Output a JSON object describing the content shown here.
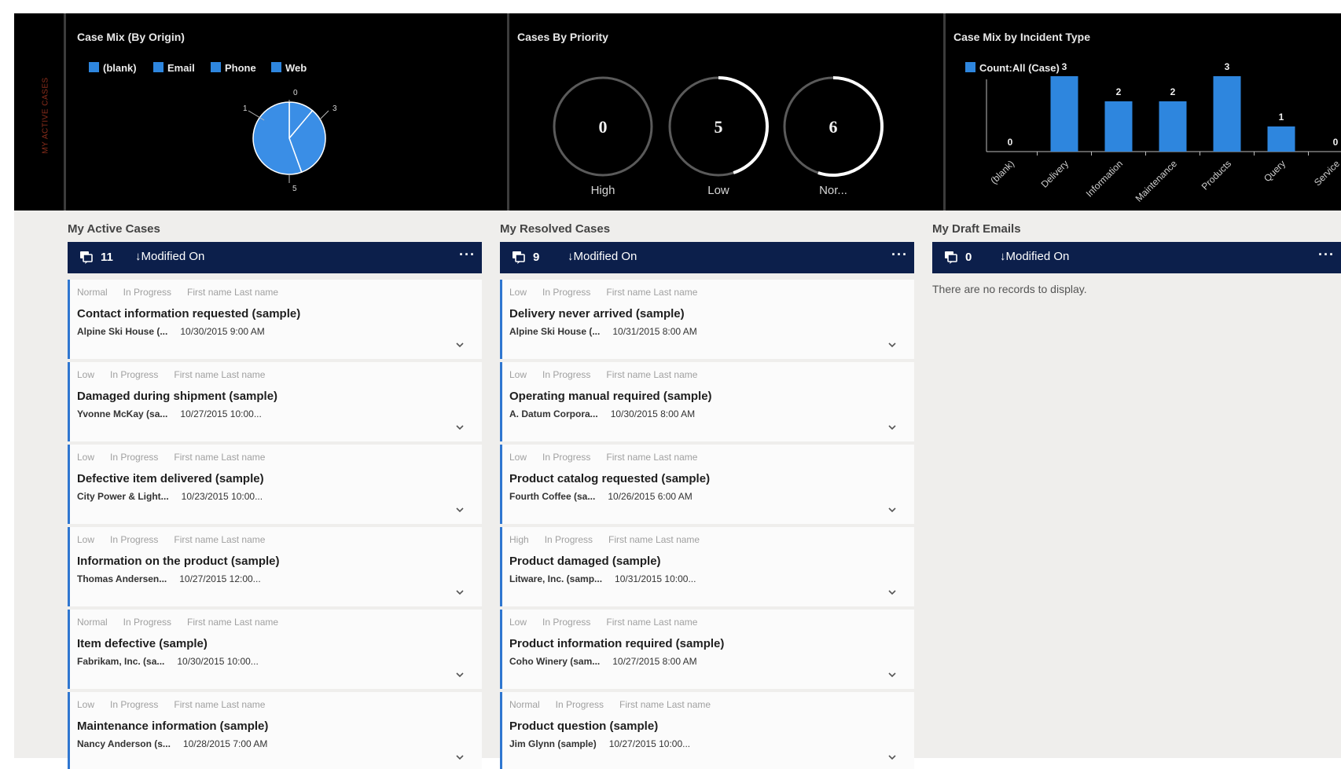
{
  "dashboard": {
    "side_label": "MY ACTIVE CASES"
  },
  "charts": {
    "origin": {
      "title": "Case Mix (By Origin)",
      "legend": [
        {
          "label": "(blank)",
          "color": "#2e86de"
        },
        {
          "label": "Email",
          "color": "#2e86de"
        },
        {
          "label": "Phone",
          "color": "#2e86de"
        },
        {
          "label": "Web",
          "color": "#2e86de"
        }
      ],
      "slice_labels": [
        "1",
        "3",
        "0",
        "5"
      ]
    },
    "priority": {
      "title": "Cases By Priority",
      "gauges": [
        {
          "value": "0",
          "label": "High",
          "fraction": 0
        },
        {
          "value": "5",
          "label": "Low",
          "fraction": 0.45
        },
        {
          "value": "6",
          "label": "Nor...",
          "fraction": 0.55
        }
      ]
    },
    "incident": {
      "title": "Case Mix by Incident Type",
      "legend_label": "Count:All (Case)"
    }
  },
  "chart_data": [
    {
      "type": "pie",
      "title": "Case Mix (By Origin)",
      "categories": [
        "(blank)",
        "Email",
        "Phone",
        "Web"
      ],
      "values": [
        1,
        3,
        5,
        0
      ],
      "legend": "top"
    },
    {
      "type": "bar",
      "title": "Case Mix by Incident Type",
      "categories": [
        "(blank)",
        "Delivery",
        "Information",
        "Maintenance",
        "Products",
        "Query",
        "Service"
      ],
      "series": [
        {
          "name": "Count:All (Case)",
          "values": [
            0,
            3,
            2,
            2,
            3,
            1,
            0
          ]
        }
      ],
      "ylim": [
        0,
        4
      ],
      "legend": "top-left"
    }
  ],
  "streams": {
    "active": {
      "title": "My Active Cases",
      "count": "11",
      "sort_label": "↓Modified On",
      "more": "···",
      "cards": [
        {
          "priority": "Normal",
          "status": "In Progress",
          "owner": "First name Last name",
          "title": "Contact information requested (sample)",
          "customer": "Alpine Ski House (...",
          "date": "10/30/2015 9:00 AM"
        },
        {
          "priority": "Low",
          "status": "In Progress",
          "owner": "First name Last name",
          "title": "Damaged during shipment (sample)",
          "customer": "Yvonne McKay (sa...",
          "date": "10/27/2015 10:00..."
        },
        {
          "priority": "Low",
          "status": "In Progress",
          "owner": "First name Last name",
          "title": "Defective item delivered (sample)",
          "customer": "City Power & Light...",
          "date": "10/23/2015 10:00..."
        },
        {
          "priority": "Low",
          "status": "In Progress",
          "owner": "First name Last name",
          "title": "Information on the product (sample)",
          "customer": "Thomas Andersen...",
          "date": "10/27/2015 12:00..."
        },
        {
          "priority": "Normal",
          "status": "In Progress",
          "owner": "First name Last name",
          "title": "Item defective (sample)",
          "customer": "Fabrikam, Inc. (sa...",
          "date": "10/30/2015 10:00..."
        },
        {
          "priority": "Low",
          "status": "In Progress",
          "owner": "First name Last name",
          "title": "Maintenance information (sample)",
          "customer": "Nancy Anderson (s...",
          "date": "10/28/2015 7:00 AM"
        }
      ]
    },
    "resolved": {
      "title": "My Resolved Cases",
      "count": "9",
      "sort_label": "↓Modified On",
      "more": "···",
      "cards": [
        {
          "priority": "Low",
          "status": "In Progress",
          "owner": "First name Last name",
          "title": "Delivery never arrived (sample)",
          "customer": "Alpine Ski House (...",
          "date": "10/31/2015 8:00 AM"
        },
        {
          "priority": "Low",
          "status": "In Progress",
          "owner": "First name Last name",
          "title": "Operating manual required (sample)",
          "customer": "A. Datum Corpora...",
          "date": "10/30/2015 8:00 AM"
        },
        {
          "priority": "Low",
          "status": "In Progress",
          "owner": "First name Last name",
          "title": "Product catalog requested (sample)",
          "customer": "Fourth Coffee (sa...",
          "date": "10/26/2015 6:00 AM"
        },
        {
          "priority": "High",
          "status": "In Progress",
          "owner": "First name Last name",
          "title": "Product damaged (sample)",
          "customer": "Litware, Inc. (samp...",
          "date": "10/31/2015 10:00..."
        },
        {
          "priority": "Low",
          "status": "In Progress",
          "owner": "First name Last name",
          "title": "Product information required (sample)",
          "customer": "Coho Winery (sam...",
          "date": "10/27/2015 8:00 AM"
        },
        {
          "priority": "Normal",
          "status": "In Progress",
          "owner": "First name Last name",
          "title": "Product question (sample)",
          "customer": "Jim Glynn (sample)",
          "date": "10/27/2015 10:00..."
        }
      ]
    },
    "drafts": {
      "title": "My Draft Emails",
      "count": "0",
      "sort_label": "↓Modified On",
      "more": "···",
      "empty_message": "There are no records to display."
    }
  }
}
